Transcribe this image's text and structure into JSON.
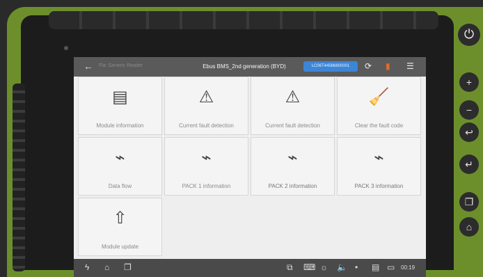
{
  "app": {
    "breadcrumb": "Fla: Generic Reader",
    "title": "Ebus BMS_2nd generation (BYD)",
    "vin": "LC06T44566800001"
  },
  "icons": {
    "power": "power-icon",
    "back": "back-arrow-icon",
    "refresh": "refresh-icon",
    "exit": "exit-icon",
    "menu": "menu-icon"
  },
  "tiles": [
    {
      "label": "Module information",
      "icon": "document-icon"
    },
    {
      "label": "Current fault detection",
      "icon": "warning-icon"
    },
    {
      "label": "Current fault detection",
      "icon": "warning-icon"
    },
    {
      "label": "Clear the fault code",
      "icon": "broom-icon"
    },
    {
      "label": "Data flow",
      "icon": "pulse-icon"
    },
    {
      "label": "PACK 1 information",
      "icon": "pulse-icon"
    },
    {
      "label": "PACK 2 information",
      "icon": "pulse-icon"
    },
    {
      "label": "PACK 3 information",
      "icon": "pulse-icon"
    },
    {
      "label": "Module update",
      "icon": "upload-arrow-icon"
    }
  ],
  "statusbar": {
    "time": "00:19"
  },
  "side_buttons": [
    "+",
    "−",
    "↩",
    "↵",
    "❐",
    "⌂"
  ],
  "colors": {
    "device_green": "#6c8f2c",
    "topbar": "#5a5a5a",
    "vin_badge": "#3b86d6",
    "screen_bg": "#eeeeee"
  }
}
